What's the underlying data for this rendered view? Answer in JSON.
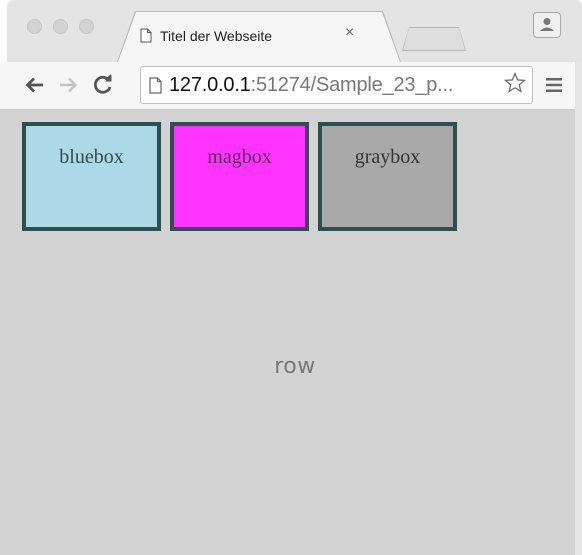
{
  "browser": {
    "tab": {
      "title": "Titel der Webseite",
      "close_glyph": "×"
    },
    "toolbar": {
      "back_glyph": "←",
      "forward_glyph": "→",
      "reload_glyph": "C",
      "url_host": "127.0.0.1",
      "url_rest": ":51274/Sample_23_p..."
    },
    "icons": [
      "page-icon",
      "star-icon",
      "menu-icon",
      "profile-icon"
    ]
  },
  "page": {
    "container_label": "row",
    "boxes": [
      {
        "label": "bluebox",
        "color": "#add8e6"
      },
      {
        "label": "magbox",
        "color": "#ff33ff"
      },
      {
        "label": "graybox",
        "color": "#a9a9a9"
      }
    ],
    "colors": {
      "background": "#d3d3d3",
      "box_border": "#2f4f4f"
    }
  }
}
